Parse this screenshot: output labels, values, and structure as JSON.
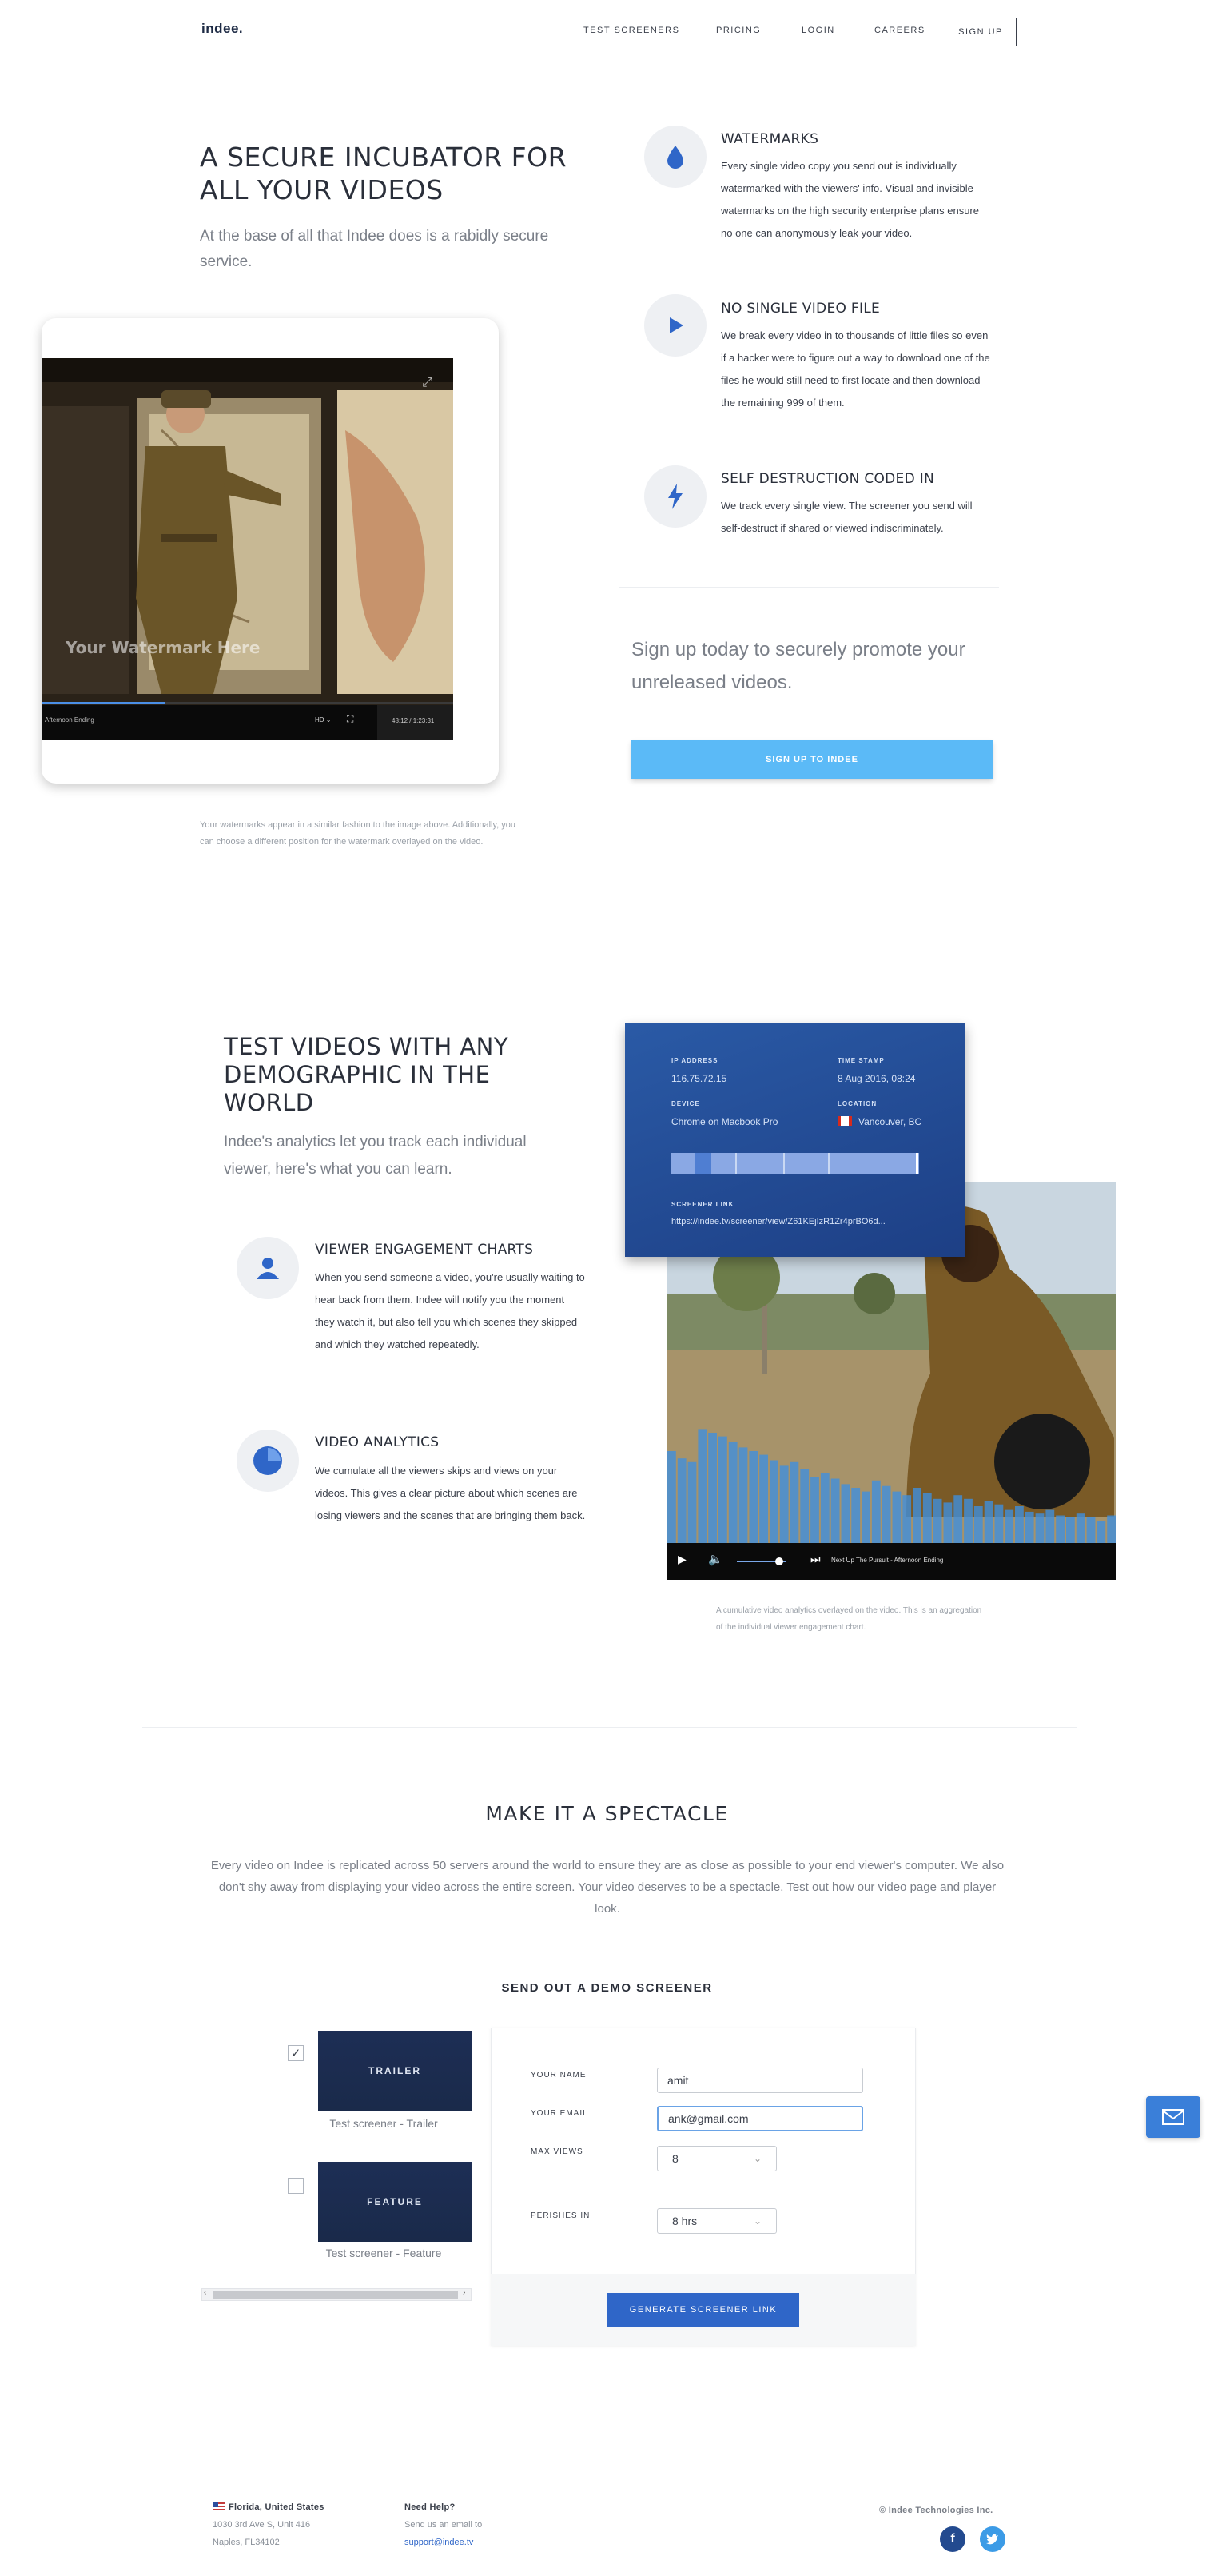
{
  "header": {
    "logo": "indee.",
    "nav": [
      "TEST SCREENERS",
      "PRICING",
      "LOGIN",
      "CAREERS"
    ],
    "signup": "SIGN UP"
  },
  "security": {
    "title": "A SECURE INCUBATOR FOR ALL YOUR VIDEOS",
    "lead": "At the base of all that Indee does is a rabidly secure service.",
    "watermark_text": "Your Watermark Here",
    "player_left": "Afternoon Ending",
    "player_quality": "HD",
    "player_time": "48:12 / 1:23:31",
    "caption": "Your watermarks appear in a similar fashion to the image above. Additionally, you can choose a different position for the watermark overlayed on the video.",
    "features": [
      {
        "icon": "water-drop-icon",
        "title": "WATERMARKS",
        "text": "Every single video copy you send out is individually watermarked with the viewers' info. Visual and invisible watermarks on the high security enterprise plans ensure no one can anonymously leak your video."
      },
      {
        "icon": "play-icon",
        "title": "NO SINGLE VIDEO FILE",
        "text": "We break every video in to thousands of little files so even if a hacker were to figure out a way to download one of the files he would still need to first locate and then download the remaining 999 of them."
      },
      {
        "icon": "lightning-icon",
        "title": "SELF DESTRUCTION CODED IN",
        "text": "We track every single view. The screener you send will self-destruct if shared or viewed indiscriminately."
      }
    ],
    "cta_text": "Sign up today to securely promote your unreleased videos.",
    "cta_button": "SIGN UP TO INDEE"
  },
  "analytics": {
    "title": "TEST VIDEOS WITH ANY DEMOGRAPHIC IN THE WORLD",
    "lead": "Indee's analytics let you track each individual viewer, here's what you can learn.",
    "card": {
      "ip_label": "IP ADDRESS",
      "ip_value": "116.75.72.15",
      "time_label": "TIME STAMP",
      "time_value": "8 Aug 2016, 08:24",
      "device_label": "DEVICE",
      "device_value": "Chrome on Macbook Pro",
      "location_label": "LOCATION",
      "location_value": "Vancouver, BC",
      "link_label": "SCREENER LINK",
      "link_value": "https://indee.tv/screener/view/Z61KEjIzR1Zr4prBO6d..."
    },
    "player2_text": "Next Up The Pursuit - Afternoon Ending",
    "caption": "A cumulative video analytics overlayed on the video. This is an aggregation of the individual viewer engagement chart.",
    "features": [
      {
        "icon": "user-icon",
        "title": "VIEWER ENGAGEMENT CHARTS",
        "text": "When you send someone a video, you're usually waiting to hear back from them. Indee will notify you the moment they watch it, but also tell you which scenes they skipped and which they watched repeatedly."
      },
      {
        "icon": "pie-chart-icon",
        "title": "VIDEO ANALYTICS",
        "text": "We cumulate all the viewers skips and views on your videos. This gives a clear picture about which scenes are losing viewers and the scenes that are bringing them back."
      }
    ],
    "engagement_bars": [
      0.5,
      0.46,
      0.44,
      0.62,
      0.6,
      0.58,
      0.55,
      0.52,
      0.5,
      0.48,
      0.45,
      0.42,
      0.44,
      0.4,
      0.36,
      0.38,
      0.35,
      0.32,
      0.3,
      0.28,
      0.34,
      0.31,
      0.28,
      0.26,
      0.3,
      0.27,
      0.24,
      0.22,
      0.26,
      0.24,
      0.2,
      0.23,
      0.21,
      0.18,
      0.2,
      0.17,
      0.16,
      0.18,
      0.15,
      0.14,
      0.16,
      0.14,
      0.12,
      0.15
    ]
  },
  "spectacle": {
    "title": "MAKE IT A SPECTACLE",
    "body": "Every video on Indee is replicated across 50 servers around the world to ensure they are as close as possible to your end viewer's computer. We also don't shy away from displaying your video across the entire screen. Your video deserves to be a spectacle. Test out how our video page and player look.",
    "demo_title": "SEND OUT A DEMO SCREENER",
    "options": [
      {
        "thumb": "TRAILER",
        "caption": "Test screener - Trailer",
        "checked": "✓"
      },
      {
        "thumb": "FEATURE",
        "caption": "Test screener - Feature",
        "checked": ""
      }
    ],
    "form": {
      "name_label": "YOUR NAME",
      "name_value": "amit",
      "email_label": "YOUR EMAIL",
      "email_value": "ank@gmail.com",
      "views_label": "MAX VIEWS",
      "views_value": "8",
      "perish_label": "PERISHES IN",
      "perish_value": "8 hrs",
      "button": "GENERATE SCREENER LINK"
    }
  },
  "footer": {
    "location": "Florida, United States",
    "address1": "1030 3rd Ave S, Unit 416",
    "address2": "Naples, FL34102",
    "help_head": "Need Help?",
    "help_line": "Send us an email to",
    "help_email": "support@indee.tv",
    "copyright": "© Indee Technologies Inc."
  },
  "colors": {
    "accent": "#2f66c8",
    "cta": "#5bbaf7",
    "card": "#1f4690"
  }
}
